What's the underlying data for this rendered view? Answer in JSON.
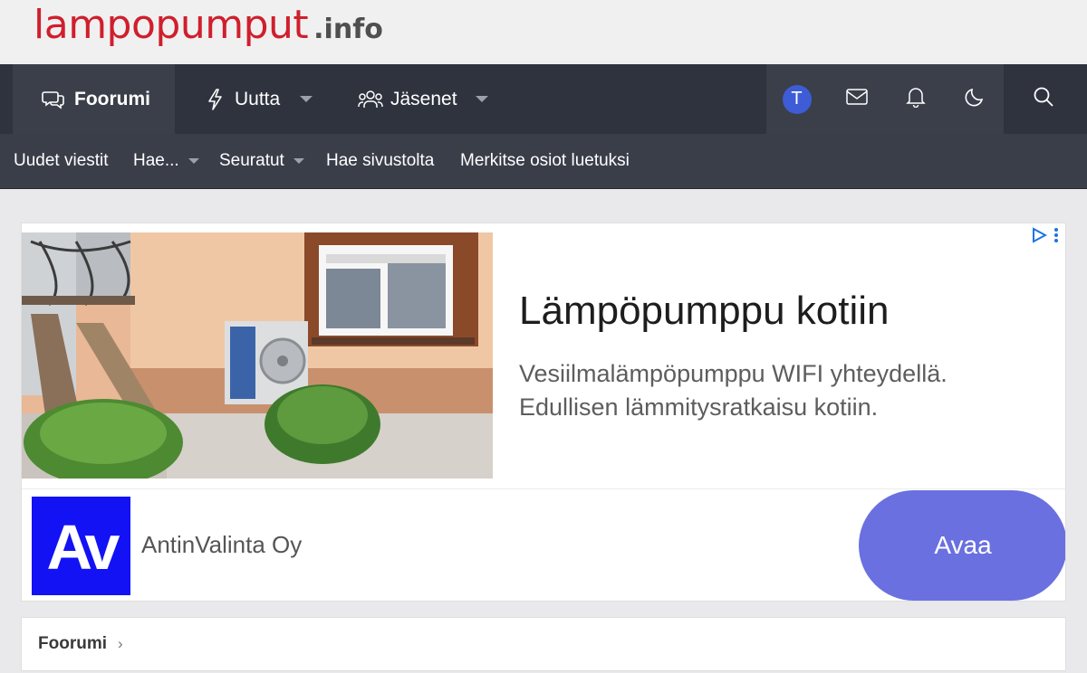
{
  "site": {
    "logo_main": "lampopumput",
    "logo_tld": ".info"
  },
  "nav": {
    "tabs": [
      {
        "label": "Foorumi",
        "icon": "chat-bubbles-icon",
        "active": true
      },
      {
        "label": "Uutta",
        "icon": "lightning-icon",
        "has_menu": true
      },
      {
        "label": "Jäsenet",
        "icon": "users-icon",
        "has_menu": true
      }
    ],
    "user_initial": "T",
    "right_icons": [
      "avatar",
      "envelope-icon",
      "bell-icon",
      "moon-icon",
      "search-icon"
    ]
  },
  "subnav": {
    "items": [
      {
        "label": "Uudet viestit"
      },
      {
        "label": "Hae...",
        "has_menu": true
      },
      {
        "label": "Seuratut",
        "has_menu": true
      },
      {
        "label": "Hae sivustolta"
      },
      {
        "label": "Merkitse osiot luetuksi"
      }
    ]
  },
  "ad": {
    "headline": "Lämpöpumppu kotiin",
    "description_line1": "Vesiilmalämpöpumppu WIFI yhteydellä.",
    "description_line2": "Edullisen lämmitysratkaisu kotiin.",
    "logo_text": "Av",
    "advertiser": "AntinValinta Oy",
    "cta_label": "Avaa",
    "cta_color": "#6a70e0",
    "logo_color": "#1212f5"
  },
  "breadcrumb": {
    "items": [
      "Foorumi"
    ],
    "separator": "›"
  },
  "colors": {
    "logo_red": "#cf1f2d",
    "nav_bg": "#2f333e",
    "subnav_bg": "#3a3e49",
    "avatar_blue": "#3d5cd6"
  }
}
